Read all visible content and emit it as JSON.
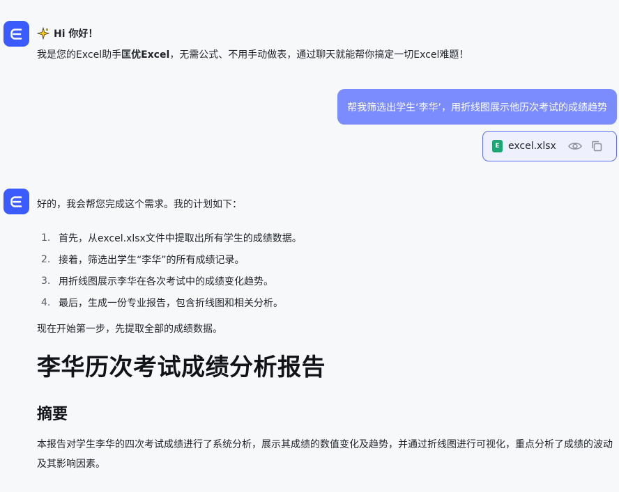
{
  "assistant": {
    "avatar_icon": "excel-e-logo-icon",
    "brand_color": "#3b5bfd"
  },
  "greeting": {
    "sparkle_icon": "sparkle-icon",
    "title": "Hi 你好！",
    "line_prefix": "我是您的Excel助手",
    "line_brand": "匡优Excel",
    "line_suffix": "，无需公式、不用手动做表，通过聊天就能帮你搞定一切Excel难题！"
  },
  "user_message": {
    "text": "帮我筛选出学生‘李华’，用折线图展示他历次考试的成绩趋势",
    "bubble_color": "#7b8cff"
  },
  "attachment": {
    "file_icon_letter": "E",
    "file_name": "excel.xlsx",
    "preview_icon": "eye-icon",
    "copy_icon": "copy-icon"
  },
  "reply": {
    "intro": "好的，我会帮您完成这个需求。我的计划如下：",
    "plan": [
      {
        "num": "1.",
        "text": "首先，从excel.xlsx文件中提取出所有学生的成绩数据。"
      },
      {
        "num": "2.",
        "text": "接着，筛选出学生“李华”的所有成绩记录。"
      },
      {
        "num": "3.",
        "text": "用折线图展示李华在各次考试中的成绩变化趋势。"
      },
      {
        "num": "4.",
        "text": "最后，生成一份专业报告，包含折线图和相关分析。"
      }
    ],
    "step_text": "现在开始第一步，先提取全部的成绩数据。"
  },
  "report": {
    "title": "李华历次考试成绩分析报告",
    "section_title": "摘要",
    "summary": "本报告对学生李华的四次考试成绩进行了系统分析，展示其成绩的数值变化及趋势，并通过折线图进行可视化，重点分析了成绩的波动及其影响因素。"
  }
}
